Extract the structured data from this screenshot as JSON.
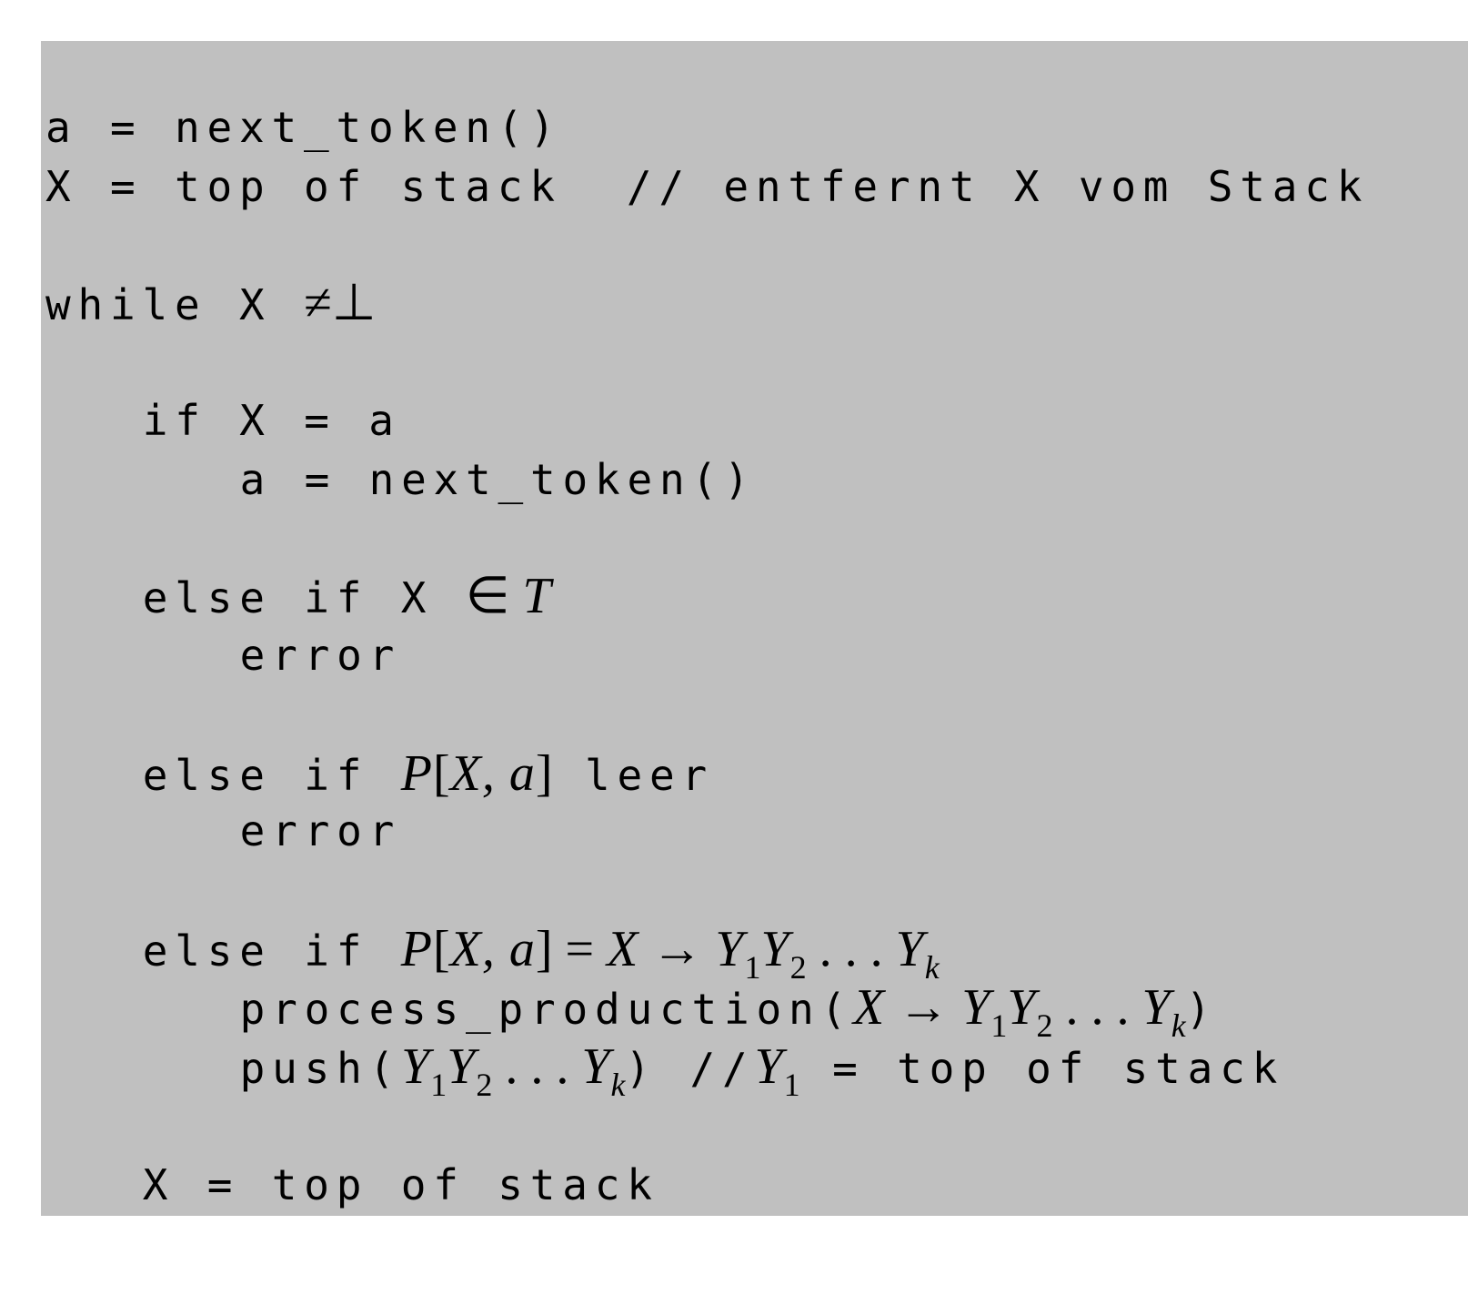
{
  "listing": {
    "lines": [
      {
        "indent": 0,
        "segments": [
          {
            "s": "code",
            "t": "a = next_token()"
          }
        ]
      },
      {
        "indent": 0,
        "segments": [
          {
            "s": "code",
            "t": "X = top of stack  // entfernt X vom Stack"
          }
        ]
      },
      {
        "indent": 0,
        "segments": [
          {
            "s": "code",
            "t": "while X "
          },
          {
            "s": "mathup",
            "t": "≠⊥"
          }
        ]
      },
      {
        "indent": 3,
        "segments": [
          {
            "s": "code",
            "t": "if X = a"
          }
        ]
      },
      {
        "indent": 6,
        "segments": [
          {
            "s": "code",
            "t": "a = next_token()"
          }
        ]
      },
      {
        "indent": 3,
        "segments": [
          {
            "s": "code",
            "t": "else if X "
          },
          {
            "s": "mathup",
            "t": "∈ "
          },
          {
            "s": "math",
            "t": "T"
          }
        ]
      },
      {
        "indent": 6,
        "segments": [
          {
            "s": "code",
            "t": "error"
          }
        ]
      },
      {
        "indent": 3,
        "segments": [
          {
            "s": "code",
            "t": "else if "
          },
          {
            "s": "math",
            "t": "P"
          },
          {
            "s": "mathup",
            "t": "["
          },
          {
            "s": "math",
            "t": "X, a"
          },
          {
            "s": "mathup",
            "t": "]"
          },
          {
            "s": "code",
            "t": " leer"
          }
        ]
      },
      {
        "indent": 6,
        "segments": [
          {
            "s": "code",
            "t": "error"
          }
        ]
      },
      {
        "indent": 3,
        "segments": [
          {
            "s": "code",
            "t": "else if "
          },
          {
            "s": "math",
            "t": "P"
          },
          {
            "s": "mathup",
            "t": "["
          },
          {
            "s": "math",
            "t": "X, a"
          },
          {
            "s": "mathup",
            "t": "] = "
          },
          {
            "s": "math",
            "t": "X"
          },
          {
            "s": "mathup",
            "t": " → "
          },
          {
            "s": "math",
            "t": "Y"
          },
          {
            "s": "sub",
            "t": "1"
          },
          {
            "s": "math",
            "t": "Y"
          },
          {
            "s": "sub",
            "t": "2"
          },
          {
            "s": "mathup",
            "t": " . . . "
          },
          {
            "s": "math",
            "t": "Y"
          },
          {
            "s": "subi",
            "t": "k"
          }
        ]
      },
      {
        "indent": 6,
        "segments": [
          {
            "s": "code",
            "t": "process_production("
          },
          {
            "s": "math",
            "t": "X"
          },
          {
            "s": "mathup",
            "t": " → "
          },
          {
            "s": "math",
            "t": "Y"
          },
          {
            "s": "sub",
            "t": "1"
          },
          {
            "s": "math",
            "t": "Y"
          },
          {
            "s": "sub",
            "t": "2"
          },
          {
            "s": "mathup",
            "t": " . . . "
          },
          {
            "s": "math",
            "t": "Y"
          },
          {
            "s": "subi",
            "t": "k"
          },
          {
            "s": "code",
            "t": ")"
          }
        ]
      },
      {
        "indent": 6,
        "segments": [
          {
            "s": "code",
            "t": "push("
          },
          {
            "s": "math",
            "t": "Y"
          },
          {
            "s": "sub",
            "t": "1"
          },
          {
            "s": "math",
            "t": "Y"
          },
          {
            "s": "sub",
            "t": "2"
          },
          {
            "s": "mathup",
            "t": " . . . "
          },
          {
            "s": "math",
            "t": "Y"
          },
          {
            "s": "subi",
            "t": "k"
          },
          {
            "s": "code",
            "t": ") //"
          },
          {
            "s": "math",
            "t": "Y"
          },
          {
            "s": "sub",
            "t": "1"
          },
          {
            "s": "code",
            "t": " = top of stack"
          }
        ]
      },
      {
        "indent": 3,
        "segments": [
          {
            "s": "code",
            "t": "X = top of stack"
          }
        ]
      }
    ]
  },
  "colors": {
    "background": "#c0c0c0",
    "text": "#000000"
  }
}
